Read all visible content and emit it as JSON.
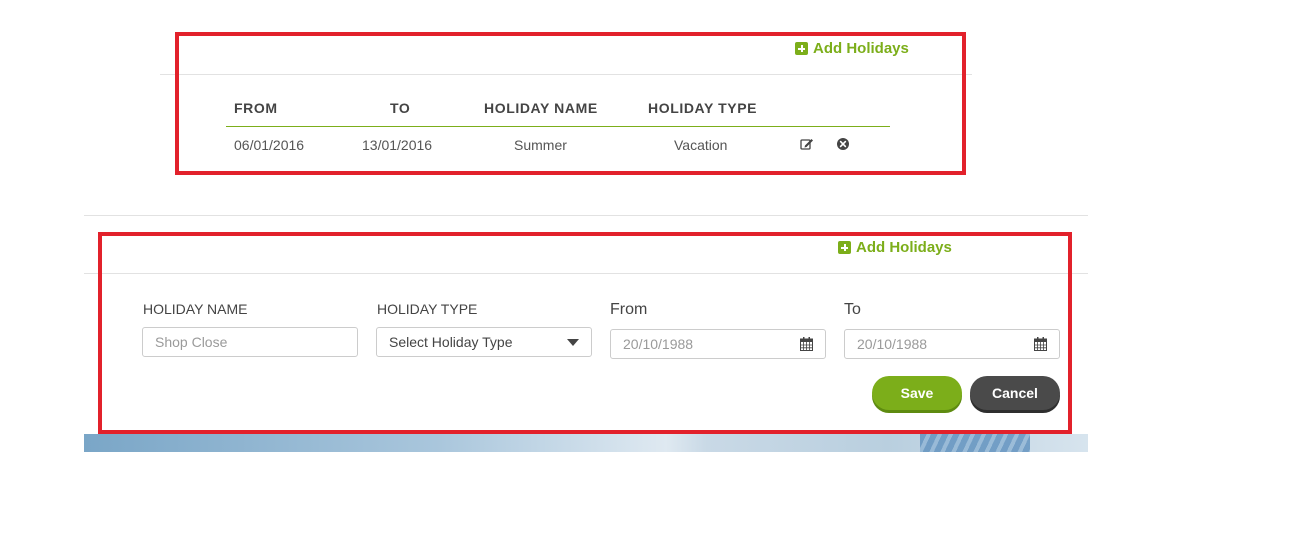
{
  "table_panel": {
    "add_label": "Add Holidays",
    "columns": [
      "FROM",
      "TO",
      "HOLIDAY NAME",
      "HOLIDAY TYPE"
    ],
    "rows": [
      {
        "from": "06/01/2016",
        "to": "13/01/2016",
        "name": "Summer",
        "type": "Vacation",
        "actions": [
          "edit-icon",
          "delete-icon"
        ]
      }
    ]
  },
  "form_panel": {
    "add_label": "Add Holidays",
    "holiday_name_label": "HOLIDAY NAME",
    "holiday_name_placeholder": "Shop Close",
    "holiday_type_label": "HOLIDAY TYPE",
    "holiday_type_selected": "Select Holiday Type",
    "from_label": "From",
    "from_value": "20/10/1988",
    "to_label": "To",
    "to_value": "20/10/1988",
    "save_label": "Save",
    "cancel_label": "Cancel"
  },
  "colors": {
    "accent": "#7cae1a",
    "highlight_box": "#e2212b",
    "cancel": "#4a4a4a"
  },
  "icons": [
    "plus-square-icon",
    "edit-icon",
    "delete-icon",
    "chevron-down-icon",
    "calendar-icon"
  ]
}
